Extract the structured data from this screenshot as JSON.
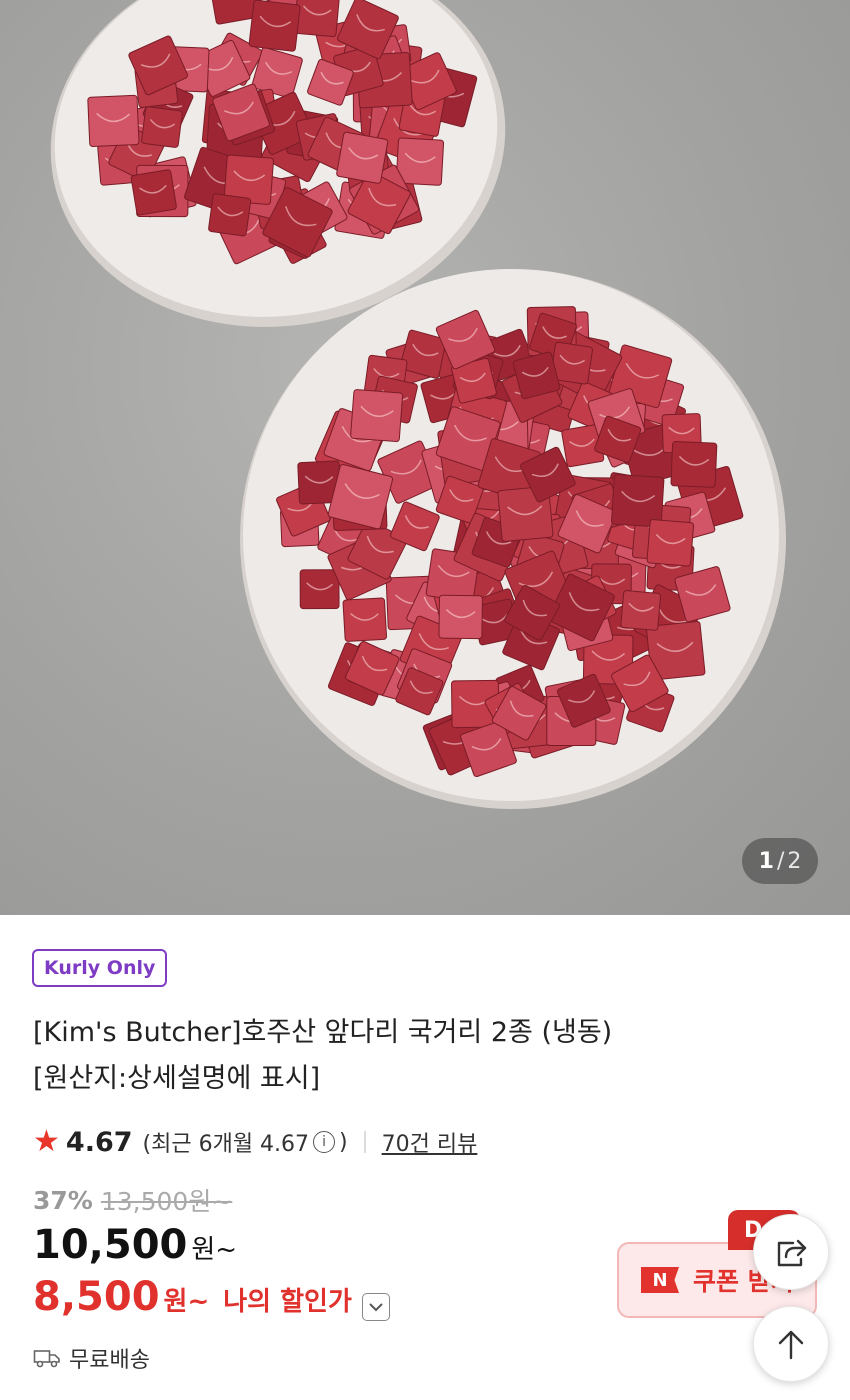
{
  "gallery": {
    "current": "1",
    "separator": "/",
    "total": "2"
  },
  "badge": "Kurly Only",
  "title_line1": "[Kim's Butcher]호주산 앞다리 국거리 2종 (냉동)",
  "title_line2": "[원산지:상세설명에 표시]",
  "rating": {
    "star": "★",
    "score": "4.67",
    "recent_prefix": "(최근 6개월 4.67",
    "recent_suffix": ")",
    "info_glyph": "i",
    "reviews": "70건 리뷰"
  },
  "price": {
    "discount_rate": "37%",
    "original": "13,500원~",
    "current": "10,500",
    "current_unit": "원~",
    "my_price": "8,500",
    "my_price_unit": "원~",
    "my_price_label": "나의 할인가"
  },
  "shipping": "무료배송",
  "coupon": {
    "logo": "N",
    "label": "쿠폰 받기",
    "badge": "D"
  },
  "icons": {
    "star": "star-icon",
    "info": "info-icon",
    "chevron": "chevron-down-icon",
    "truck": "truck-icon",
    "share": "share-icon",
    "top": "arrow-up-icon"
  },
  "colors": {
    "accent_purple": "#7e3cc4",
    "accent_red": "#e0312c",
    "star": "#e8362a"
  }
}
